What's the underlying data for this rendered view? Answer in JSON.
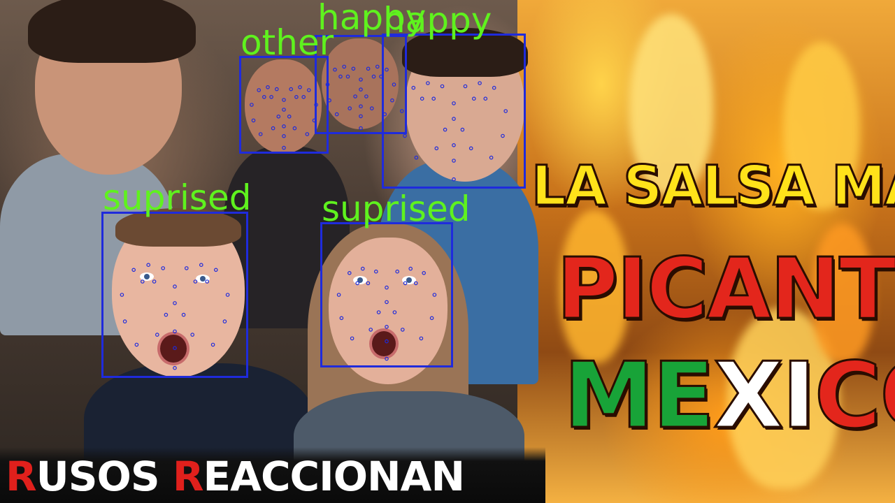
{
  "thumbnail": {
    "title_lines": [
      {
        "parts": [
          {
            "text": "LA SALSA MÁS",
            "color": "#ffe21a"
          }
        ]
      },
      {
        "parts": [
          {
            "text": "PICANTE",
            "color": "#e3261c"
          }
        ]
      },
      {
        "parts": [
          {
            "text": "ME",
            "color": "#18a338"
          },
          {
            "text": "XI",
            "color": "#ffffff"
          },
          {
            "text": "CO",
            "color": "#e3261c"
          }
        ]
      }
    ],
    "caption": {
      "parts": [
        {
          "text": "R",
          "style": "red"
        },
        {
          "text": "USOS ",
          "style": "white"
        },
        {
          "text": "R",
          "style": "red"
        },
        {
          "text": "EACCIONAN",
          "style": "white"
        }
      ]
    }
  },
  "detections": [
    {
      "id": "face-1",
      "label": "other"
    },
    {
      "id": "face-2",
      "label": "happy"
    },
    {
      "id": "face-3",
      "label": "happy"
    },
    {
      "id": "face-4",
      "label": "suprised"
    },
    {
      "id": "face-5",
      "label": "suprised"
    }
  ],
  "colors": {
    "box": "#1f2bdc",
    "label": "#5ff21e",
    "caption_red": "#e0201c",
    "caption_white": "#ffffff"
  }
}
